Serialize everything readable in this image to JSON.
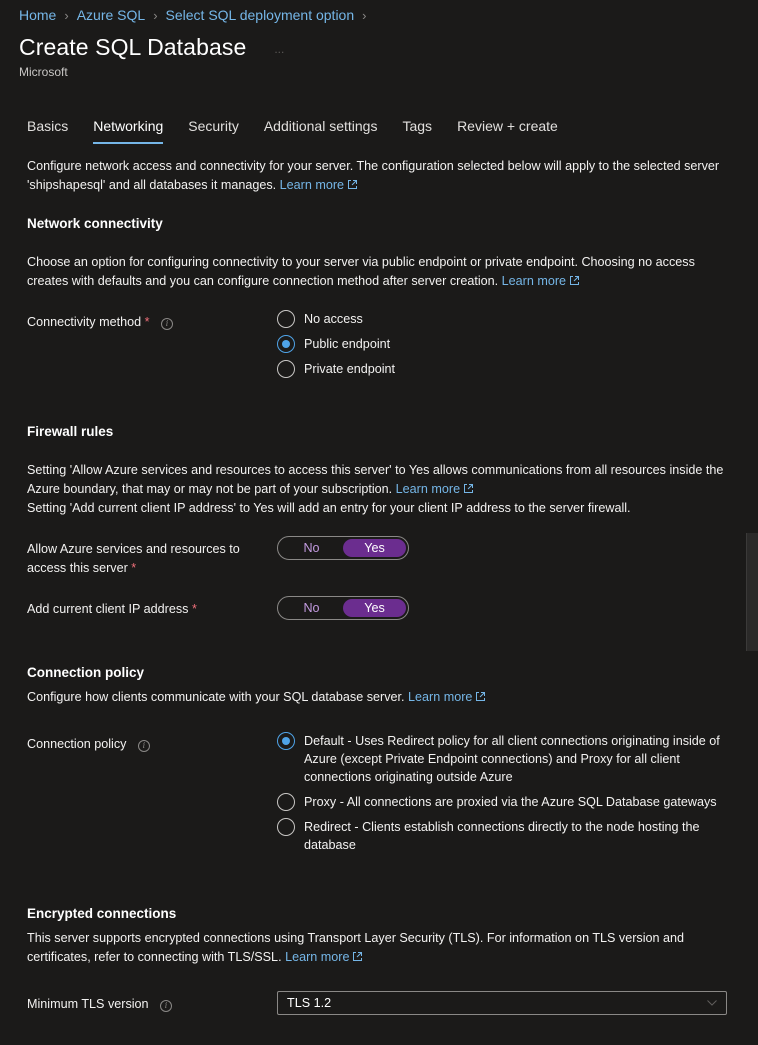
{
  "breadcrumb": {
    "items": [
      "Home",
      "Azure SQL",
      "Select SQL deployment option"
    ]
  },
  "header": {
    "title": "Create SQL Database",
    "ellipsis": "...",
    "subtitle": "Microsoft"
  },
  "tabs": [
    "Basics",
    "Networking",
    "Security",
    "Additional settings",
    "Tags",
    "Review + create"
  ],
  "active_tab": "Networking",
  "intro": {
    "text": "Configure network access and connectivity for your server. The configuration selected below will apply to the selected server 'shipshapesql' and all databases it manages.",
    "link": "Learn more"
  },
  "network_connectivity": {
    "heading": "Network connectivity",
    "text": "Choose an option for configuring connectivity to your server via public endpoint or private endpoint. Choosing no access creates with defaults and you can configure connection method after server creation.",
    "link": "Learn more",
    "field_label": "Connectivity method",
    "required_mark": "*",
    "options": [
      "No access",
      "Public endpoint",
      "Private endpoint"
    ],
    "selected": "Public endpoint"
  },
  "firewall": {
    "heading": "Firewall rules",
    "text1": "Setting 'Allow Azure services and resources to access this server' to Yes allows communications from all resources inside the Azure boundary, that may or may not be part of your subscription.",
    "link": "Learn more",
    "text2": "Setting 'Add current client IP address' to Yes will add an entry for your client IP address to the server firewall.",
    "allow_azure": {
      "label_line1": "Allow Azure services and resources to",
      "label_line2": "access this server",
      "required_mark": "*",
      "no": "No",
      "yes": "Yes",
      "value": "Yes"
    },
    "client_ip": {
      "label": "Add current client IP address",
      "required_mark": "*",
      "no": "No",
      "yes": "Yes",
      "value": "Yes"
    }
  },
  "connection_policy": {
    "heading": "Connection policy",
    "text": "Configure how clients communicate with your SQL database server.",
    "link": "Learn more",
    "field_label": "Connection policy",
    "options": [
      "Default - Uses Redirect policy for all client connections originating inside of Azure (except Private Endpoint connections) and Proxy for all client connections originating outside Azure",
      "Proxy - All connections are proxied via the Azure SQL Database gateways",
      "Redirect - Clients establish connections directly to the node hosting the database"
    ],
    "selected_index": 0
  },
  "encryption": {
    "heading": "Encrypted connections",
    "text": "This server supports encrypted connections using Transport Layer Security (TLS). For information on TLS version and certificates, refer to connecting with TLS/SSL.",
    "link": "Learn more",
    "field_label": "Minimum TLS version",
    "value": "TLS 1.2"
  },
  "colors": {
    "background": "#1b1a19",
    "link": "#75b6e7",
    "toggle_selected": "#6b2d8f",
    "radio_checked": "#4fa3e7",
    "required": "#f1707b"
  },
  "icons": {
    "info": "info-icon",
    "external_link": "external-link-icon",
    "breadcrumb_separator": "chevron-right-icon",
    "dropdown": "chevron-down-icon"
  }
}
